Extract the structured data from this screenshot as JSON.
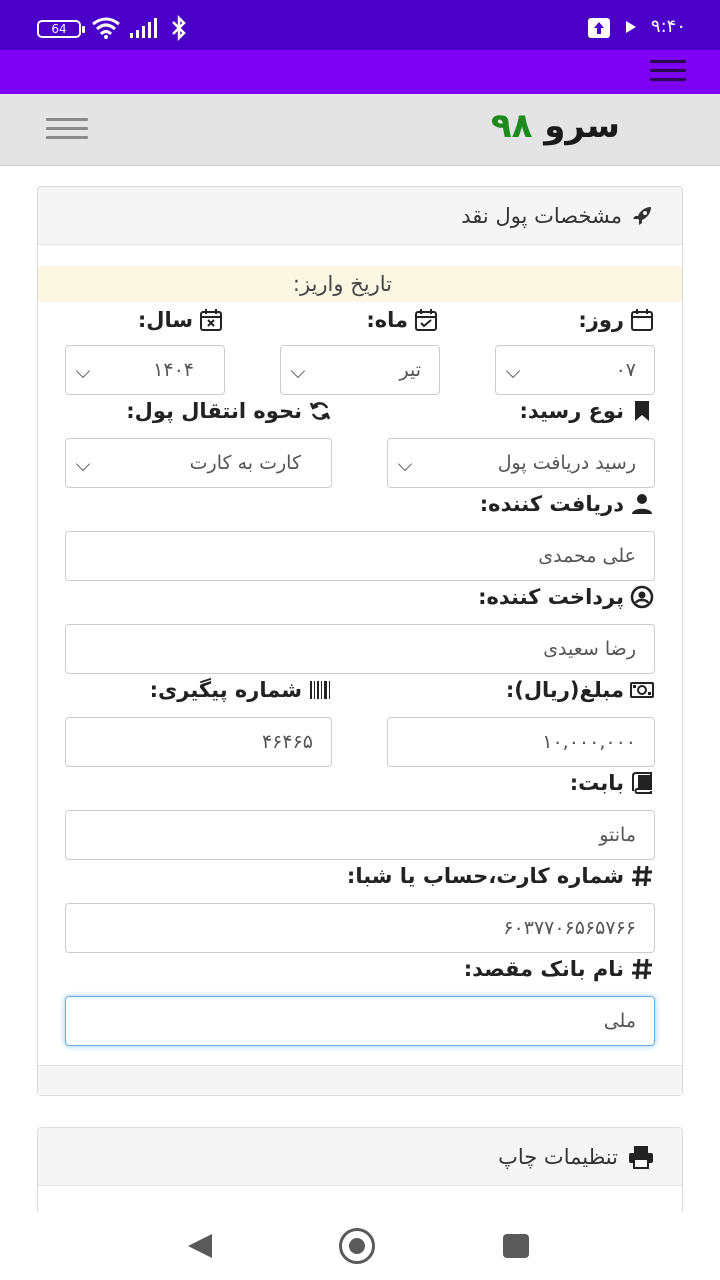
{
  "status_bar": {
    "battery": "64",
    "time": "۹:۴۰"
  },
  "header": {
    "logo_text": "سرو",
    "logo_number": "۹۸"
  },
  "card": {
    "title": "مشخصات پول نقد",
    "date_notice": "تاریخ واریز:",
    "day_label": "روز:",
    "month_label": "ماه:",
    "year_label": "سال:",
    "day_value": "۰۷",
    "month_value": "تیر",
    "year_value": "۱۴۰۴",
    "receipt_type_label": "نوع رسید:",
    "receipt_type_value": "رسید دریافت پول",
    "transfer_method_label": "نحوه انتقال پول:",
    "transfer_method_value": "کارت به کارت",
    "receiver_label": "دریافت کننده:",
    "receiver_value": "علی محمدی",
    "payer_label": "پرداخت کننده:",
    "payer_value": "رضا سعیدی",
    "amount_label": "مبلغ(ریال):",
    "amount_value": "۱۰,۰۰۰,۰۰۰",
    "tracking_label": "شماره پیگیری:",
    "tracking_value": "۴۶۴۶۵",
    "reason_label": "بابت:",
    "reason_value": "مانتو",
    "account_label": "شماره کارت،حساب یا شبا:",
    "account_value": "۶۰۳۷۷۰۶۵۶۵۷۶۶",
    "bank_label": "نام بانک مقصد:",
    "bank_value": "ملی"
  },
  "print_card": {
    "title": "تنظیمات چاپ"
  },
  "colors": {
    "status_bar": "#4a00c8",
    "nav_bar": "#7d00f5",
    "logo_number": "#1e8a1e"
  }
}
